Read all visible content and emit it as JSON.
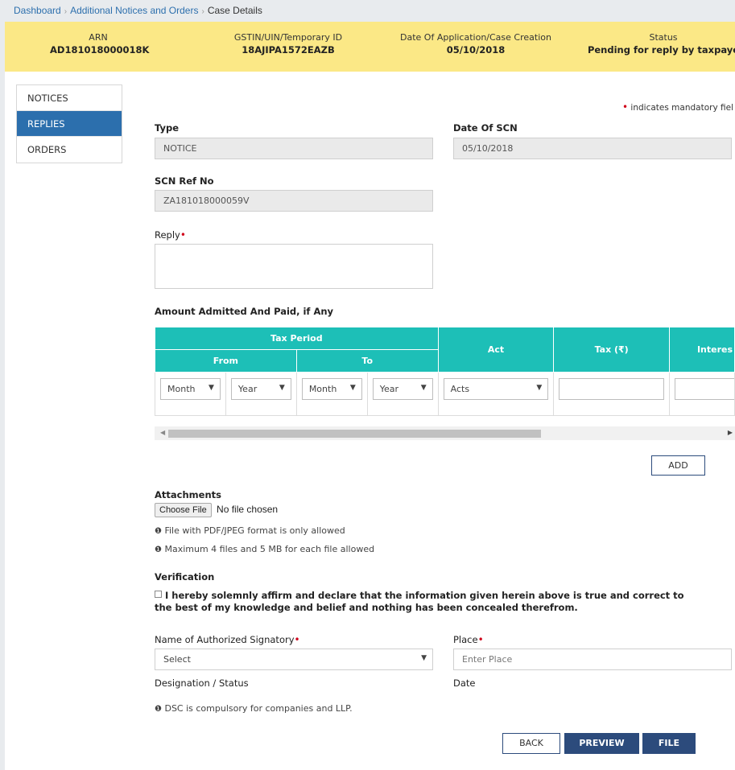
{
  "breadcrumb": {
    "home": "Dashboard",
    "section": "Additional Notices and Orders",
    "current": "Case Details",
    "separator": "›"
  },
  "info_bar": {
    "arn_label": "ARN",
    "arn_value": "AD181018000018K",
    "gstin_label": "GSTIN/UIN/Temporary ID",
    "gstin_value": "18AJIPA1572EAZB",
    "date_label": "Date Of Application/Case Creation",
    "date_value": "05/10/2018",
    "status_label": "Status",
    "status_value": "Pending for reply by taxpaye"
  },
  "side_nav": {
    "items": [
      {
        "label": "NOTICES",
        "active": false
      },
      {
        "label": "REPLIES",
        "active": true
      },
      {
        "label": "ORDERS",
        "active": false
      }
    ]
  },
  "form": {
    "mandatory_note": "indicates mandatory fiel",
    "type_label": "Type",
    "type_value": "NOTICE",
    "date_scn_label": "Date Of SCN",
    "date_scn_value": "05/10/2018",
    "scn_ref_label": "SCN Ref No",
    "scn_ref_value": "ZA181018000059V",
    "reply_label": "Reply",
    "amount_heading": "Amount Admitted And Paid, if Any"
  },
  "amount_table": {
    "tax_period_header": "Tax Period",
    "from_header": "From",
    "to_header": "To",
    "act_header": "Act",
    "tax_header": "Tax (₹)",
    "interest_header": "Interes",
    "from_month": "Month",
    "from_year": "Year",
    "to_month": "Month",
    "to_year": "Year",
    "act_value": "Acts"
  },
  "buttons": {
    "add": "ADD",
    "back": "BACK",
    "preview": "PREVIEW",
    "file": "FILE",
    "choose_file": "Choose File"
  },
  "attachments": {
    "heading": "Attachments",
    "no_file": "No file chosen",
    "note1": "File with PDF/JPEG format is only allowed",
    "note2": "Maximum 4 files and 5 MB for each file allowed"
  },
  "verification": {
    "heading": "Verification",
    "declaration": "I hereby solemnly affirm and declare that the information given herein above is true and correct to the best of my knowledge and belief and nothing has been concealed therefrom.",
    "signatory_label": "Name of Authorized Signatory",
    "signatory_value": "Select",
    "place_label": "Place",
    "place_placeholder": "Enter Place",
    "designation_label": "Designation / Status",
    "date_label": "Date",
    "dsc_note": "DSC is compulsory for companies and LLP."
  },
  "colors": {
    "info_bar": "#fbe886",
    "nav_active": "#2c6fad",
    "table_header": "#1dbfb7",
    "primary_button": "#2c4b7c",
    "required": "#d0021b"
  }
}
